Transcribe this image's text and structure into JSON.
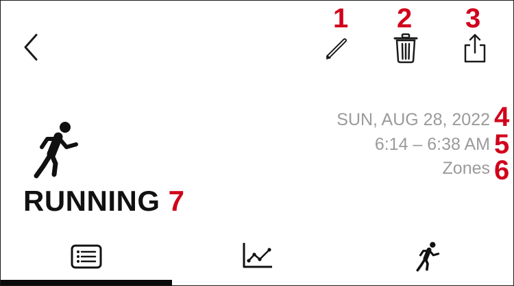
{
  "toolbar": {
    "back_icon": "chevron-left-icon",
    "edit_icon": "pencil-icon",
    "delete_icon": "trash-icon",
    "share_icon": "share-icon"
  },
  "annotations": {
    "edit": "1",
    "delete": "2",
    "share": "3",
    "date": "4",
    "time": "5",
    "zones": "6",
    "title": "7"
  },
  "workout": {
    "icon": "running-figure-icon",
    "date": "SUN, AUG 28, 2022",
    "time_range": "6:14 – 6:38 AM",
    "zones_label": "Zones",
    "title": "RUNNING"
  },
  "tabs": [
    {
      "icon": "list-icon",
      "selected": true
    },
    {
      "icon": "chart-icon",
      "selected": false
    },
    {
      "icon": "running-figure-icon",
      "selected": false
    }
  ],
  "colors": {
    "annotation": "#d0021b",
    "meta_text": "#9a9a9a",
    "text": "#111111",
    "tab_indicator": "#0a0a0a"
  }
}
